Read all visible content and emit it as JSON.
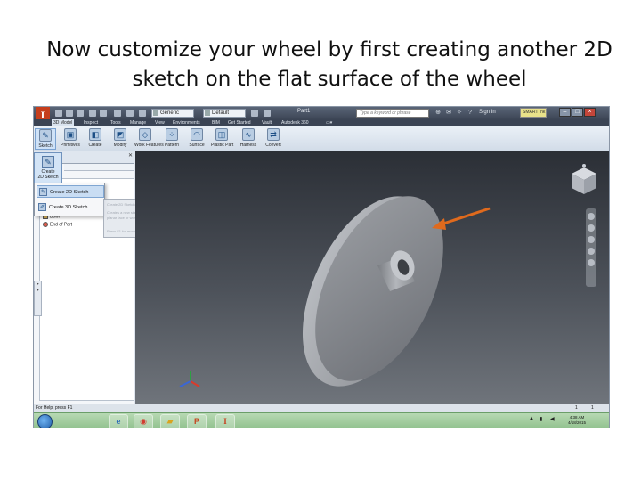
{
  "slide": {
    "title_line1": "Now customize your wheel by first creating another 2D",
    "title_line2": "sketch on the flat surface of the wheel"
  },
  "app": {
    "logo_letter": "I",
    "window_title": "Part1",
    "quick_access": {
      "material": "Generic",
      "appearance": "Default"
    },
    "search_placeholder": "Type a keyword or phrase",
    "signin_label": "Sign In",
    "smart_label": "SMART Ink",
    "tabs": [
      "3D Model",
      "Inspect",
      "Tools",
      "Manage",
      "View",
      "Environments",
      "BIM",
      "Get Started",
      "Vault",
      "Autodesk 360"
    ],
    "active_tab": "3D Model",
    "ribbon_buttons": [
      "Sketch",
      "Primitives",
      "Create",
      "Modify",
      "Work Features",
      "Pattern",
      "Surface",
      "Plastic Part",
      "Harness",
      "Convert"
    ],
    "sketch_drop": {
      "line1": "Create",
      "line2": "2D Sketch"
    },
    "dropdown": {
      "item1": "Create 2D Sketch",
      "item2": "Create 3D Sketch"
    },
    "tooltip_lines": [
      "Create 2D Sketch",
      "Creates a new sketch on a planar face or work plane, select a",
      "planar face or work plane to create sketch",
      "Press F1 for more help"
    ],
    "tree": {
      "row1": "Bowl",
      "row2": "End of Part"
    },
    "statusbar": {
      "help_text": "For Help, press F1",
      "page_a": "1",
      "page_b": "1"
    },
    "clock": {
      "time": "4:38 AM",
      "date": "4/18/2015"
    },
    "colors": {
      "arrow": "#e06a1d",
      "titlebar": "#3c4555",
      "viewport_top": "#2b2f36",
      "model": "#8a8d93"
    },
    "icons": [
      "inventor-logo-icon",
      "sketch-icon",
      "viewcube-icon",
      "orange-arrow-icon",
      "windows-start-icon",
      "ie-icon",
      "chrome-icon",
      "folder-icon",
      "powerpoint-icon",
      "inventor-taskbar-icon"
    ]
  }
}
